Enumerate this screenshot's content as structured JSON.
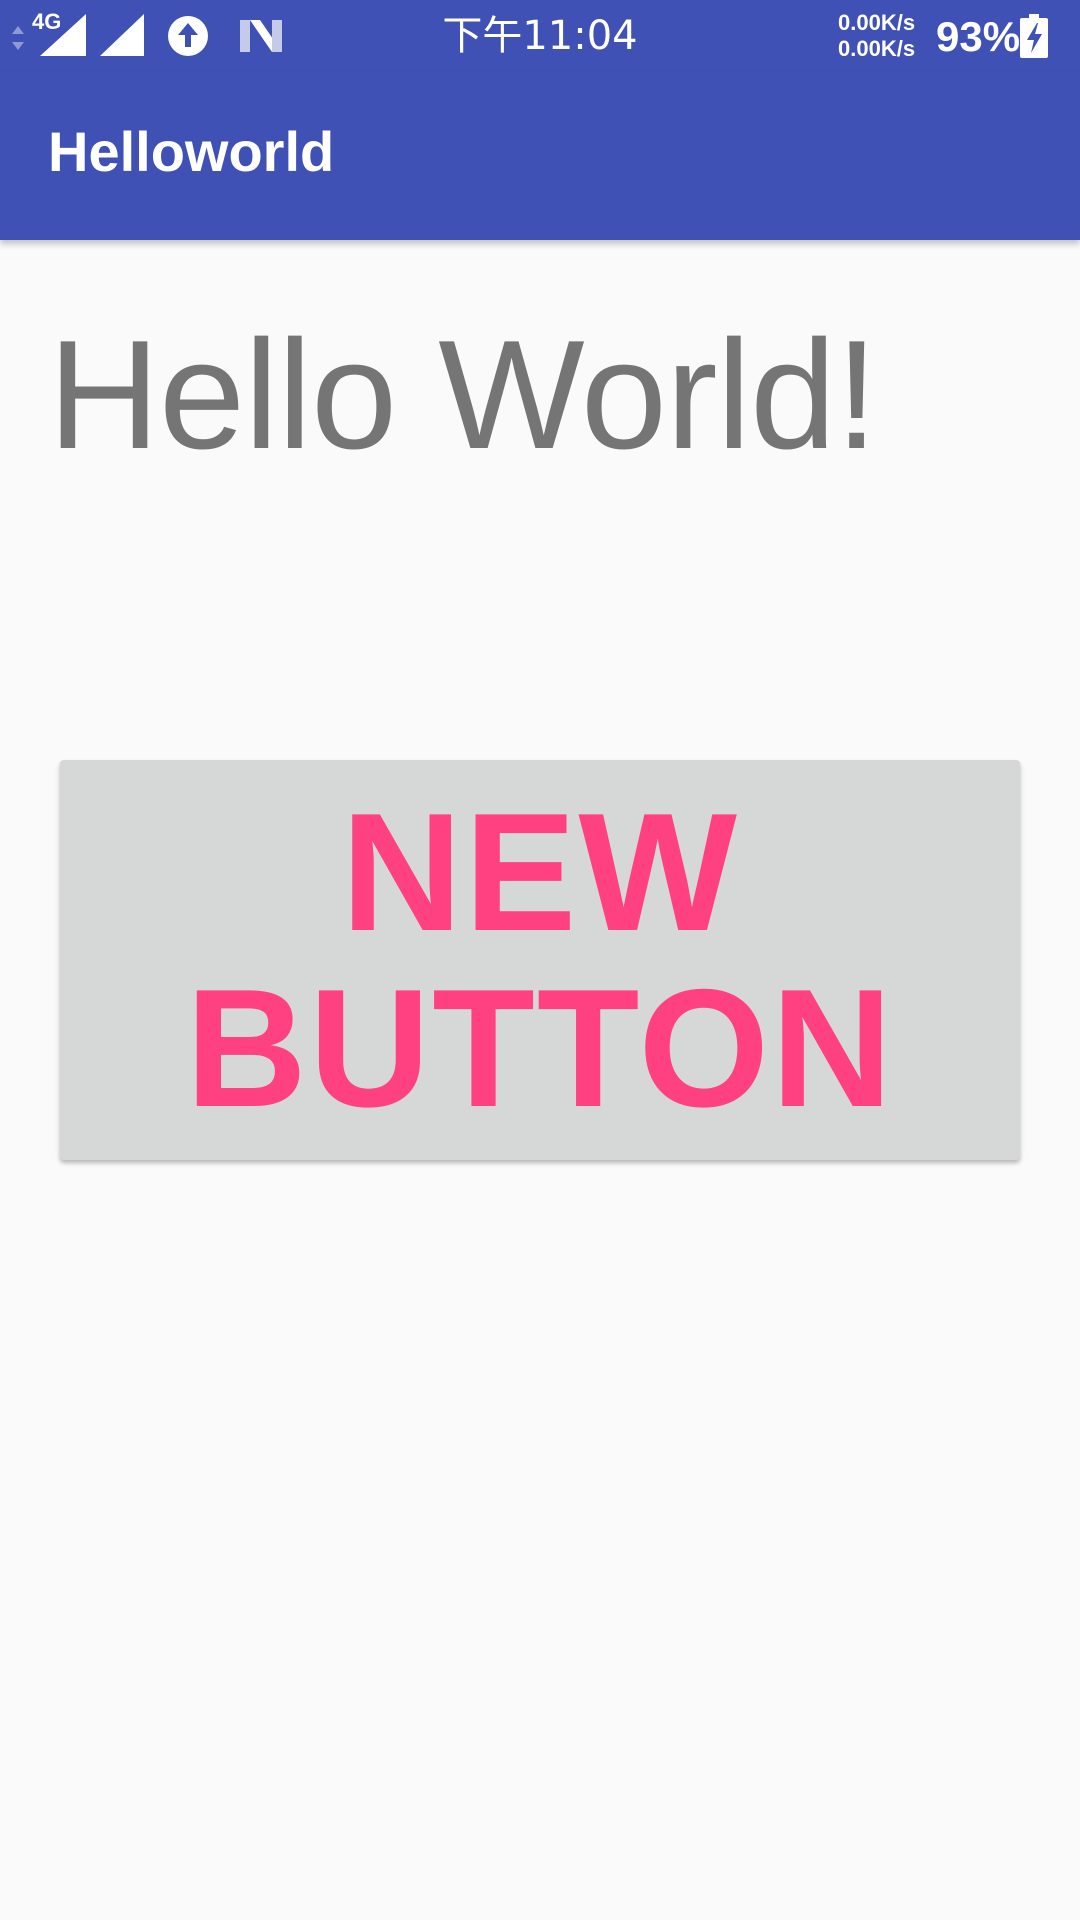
{
  "status_bar": {
    "network_type": "4G",
    "time": "下午11:04",
    "upload_speed": "0.00K/s",
    "download_speed": "0.00K/s",
    "battery_percent": "93%",
    "icons": [
      "data-arrows-icon",
      "signal-icon",
      "signal-icon",
      "upload-icon",
      "n-icon",
      "battery-charging-icon"
    ]
  },
  "app_bar": {
    "title": "Helloworld"
  },
  "main": {
    "hello_text": "Hello World!",
    "button_label": "NEW BUTTON"
  },
  "colors": {
    "primary": "#3f51b5",
    "accent": "#ff4081",
    "background": "#fafafa",
    "button_bg": "#d6d7d7",
    "text_gray": "#757575"
  }
}
